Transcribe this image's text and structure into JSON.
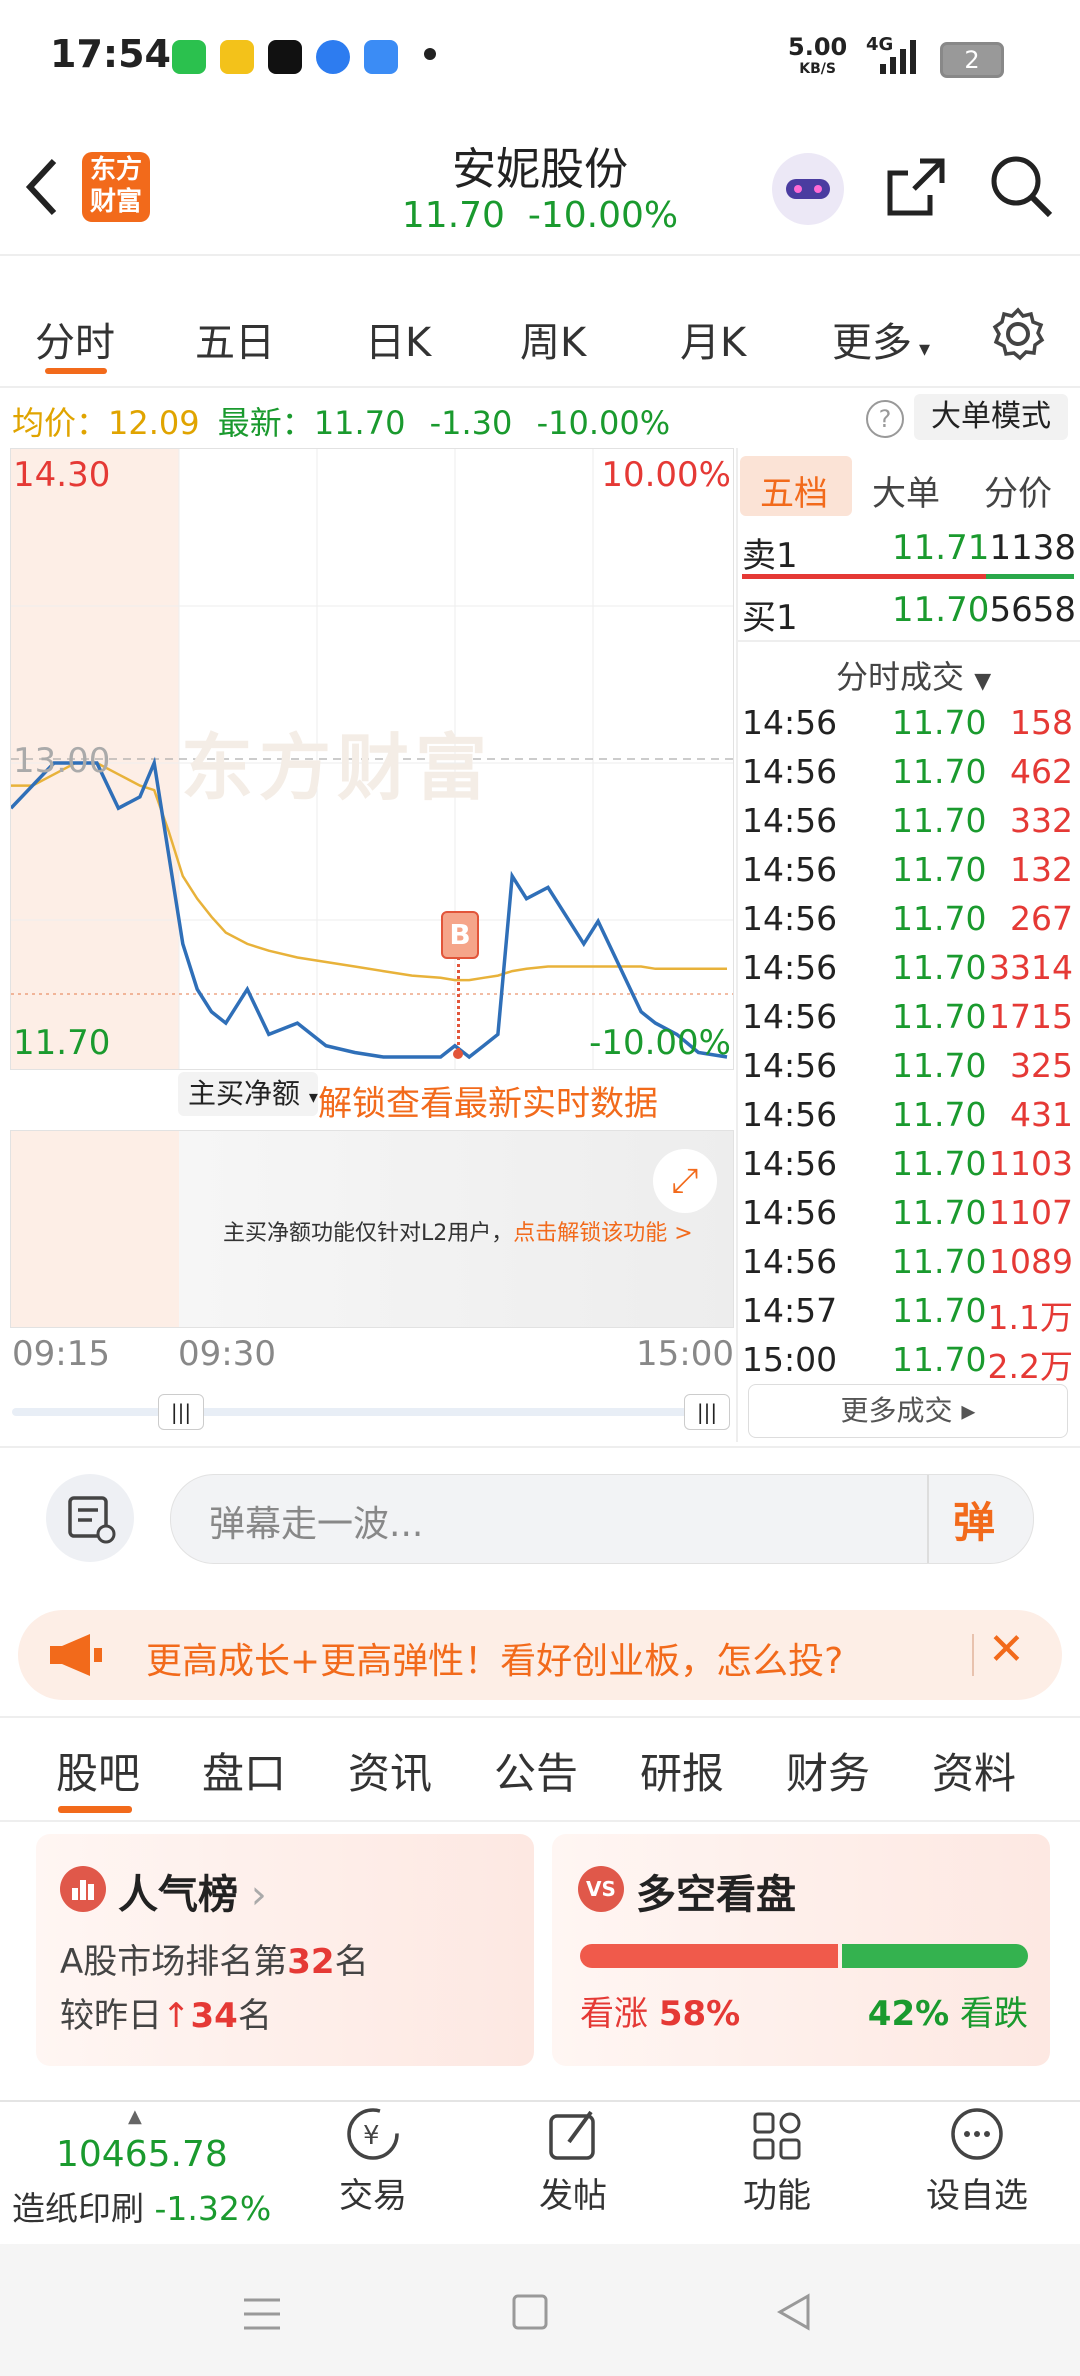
{
  "status_bar": {
    "time": "17:54",
    "net_speed": "5.00",
    "net_unit": "KB/S",
    "signal": "4G",
    "battery": "2"
  },
  "header": {
    "logo_text_1": "东方",
    "logo_text_2": "财富",
    "stock_name": "安妮股份",
    "price": "11.70",
    "change_pct": "-10.00%"
  },
  "tabs": [
    "分时",
    "五日",
    "日K",
    "周K",
    "月K",
    "更多"
  ],
  "info_bar": {
    "avg_label": "均价：",
    "avg_value": "12.09",
    "latest_label": "最新：",
    "latest_value": "11.70",
    "change": "-1.30",
    "change_pct": "-10.00%",
    "mode_button": "大单模式"
  },
  "chart": {
    "high_label": "14.30",
    "high_pct": "10.00%",
    "ref_label": "13.00",
    "low_label": "11.70",
    "low_pct": "-10.00%",
    "watermark": "东方财富",
    "marker": "B",
    "net_dropdown": "主买净额",
    "unlock_text": "解锁查看最新实时数据",
    "l2_notice": "主买净额功能仅针对L2用户，",
    "l2_link": "点击解锁该功能 >",
    "time_start": "09:15",
    "time_open": "09:30",
    "time_end": "15:00"
  },
  "chart_data": {
    "type": "line",
    "ylim": [
      11.7,
      14.3
    ],
    "ref_price": 13.0,
    "series": [],
    "x": [
      0,
      0.03,
      0.06,
      0.09,
      0.12,
      0.15,
      0.18,
      0.2,
      0.22,
      0.24,
      0.26,
      0.28,
      0.3,
      0.33,
      0.36,
      0.4,
      0.44,
      0.48,
      0.52,
      0.56,
      0.6,
      0.62,
      0.64,
      0.66,
      0.68,
      0.7,
      0.72,
      0.75,
      0.78,
      0.8,
      0.82,
      0.85,
      0.88,
      0.9,
      0.93,
      0.96,
      1.0
    ],
    "price": [
      12.8,
      12.9,
      13.0,
      13.0,
      13.0,
      12.8,
      12.85,
      13.0,
      12.6,
      12.2,
      12.0,
      11.9,
      11.85,
      12.0,
      11.8,
      11.85,
      11.75,
      11.72,
      11.7,
      11.7,
      11.7,
      11.75,
      11.7,
      11.75,
      11.8,
      12.5,
      12.4,
      12.45,
      12.3,
      12.2,
      12.3,
      12.1,
      11.9,
      11.85,
      11.8,
      11.72,
      11.7
    ],
    "avg_price": [
      12.9,
      12.9,
      12.95,
      13.0,
      13.0,
      12.95,
      12.9,
      12.88,
      12.7,
      12.5,
      12.4,
      12.32,
      12.25,
      12.2,
      12.17,
      12.14,
      12.12,
      12.1,
      12.08,
      12.06,
      12.05,
      12.04,
      12.04,
      12.05,
      12.06,
      12.08,
      12.09,
      12.1,
      12.1,
      12.1,
      12.1,
      12.1,
      12.1,
      12.09,
      12.09,
      12.09,
      12.09
    ]
  },
  "order_book": {
    "tabs": [
      "五档",
      "大单",
      "分价"
    ],
    "sell1": {
      "label": "卖1",
      "price": "11.71",
      "volume": "1138"
    },
    "buy1": {
      "label": "买1",
      "price": "11.70",
      "volume": "5658"
    },
    "trades_title": "分时成交",
    "trades": [
      {
        "time": "14:56",
        "price": "11.70",
        "vol": "158"
      },
      {
        "time": "14:56",
        "price": "11.70",
        "vol": "462"
      },
      {
        "time": "14:56",
        "price": "11.70",
        "vol": "332"
      },
      {
        "time": "14:56",
        "price": "11.70",
        "vol": "132"
      },
      {
        "time": "14:56",
        "price": "11.70",
        "vol": "267"
      },
      {
        "time": "14:56",
        "price": "11.70",
        "vol": "3314"
      },
      {
        "time": "14:56",
        "price": "11.70",
        "vol": "1715"
      },
      {
        "time": "14:56",
        "price": "11.70",
        "vol": "325"
      },
      {
        "time": "14:56",
        "price": "11.70",
        "vol": "431"
      },
      {
        "time": "14:56",
        "price": "11.70",
        "vol": "1103"
      },
      {
        "time": "14:56",
        "price": "11.70",
        "vol": "1107"
      },
      {
        "time": "14:56",
        "price": "11.70",
        "vol": "1089"
      },
      {
        "time": "14:57",
        "price": "11.70",
        "vol": "1.1万"
      },
      {
        "time": "15:00",
        "price": "11.70",
        "vol": "2.2万"
      }
    ],
    "more_trades": "更多成交"
  },
  "comment": {
    "placeholder": "弹幕走一波...",
    "danmu_button": "弹"
  },
  "banner": {
    "text": "更高成长+更高弹性！看好创业板，怎么投?"
  },
  "bottom_tabs": [
    "股吧",
    "盘口",
    "资讯",
    "公告",
    "研报",
    "财务",
    "资料"
  ],
  "popularity": {
    "title": "人气榜",
    "rank_prefix": "A股市场排名第",
    "rank": "32",
    "rank_suffix": "名",
    "compare_prefix": "较昨日",
    "compare_value": "34",
    "compare_suffix": "名"
  },
  "bull_bear": {
    "title": "多空看盘",
    "up_label": "看涨",
    "up_pct": "58%",
    "down_pct": "42%",
    "down_label": "看跌",
    "up_fraction": 0.58
  },
  "bottom_nav": {
    "index_value": "10465.78",
    "index_name": "造纸印刷",
    "index_change": "-1.32%",
    "items": [
      "交易",
      "发帖",
      "功能",
      "设自选"
    ]
  },
  "colors": {
    "accent": "#f26a1b",
    "up": "#e53935",
    "down": "#1a9a2e",
    "line": "#2f6fb8",
    "avg": "#e8b23a"
  }
}
